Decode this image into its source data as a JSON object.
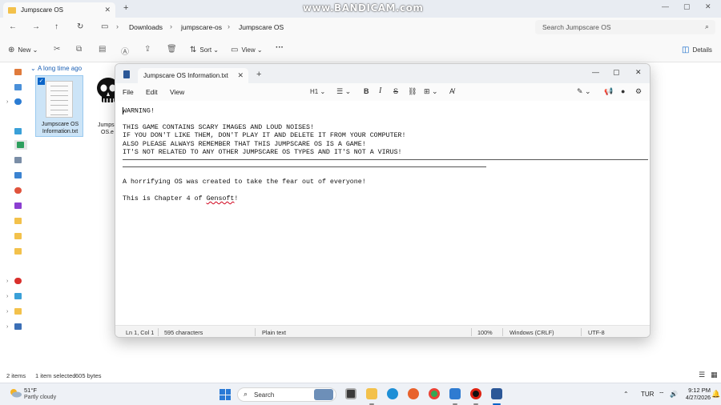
{
  "explorer": {
    "tab_title": "Jumpscare OS",
    "tab_close": "✕",
    "new_tab": "+",
    "win_min": "—",
    "win_max": "▢",
    "win_close": "✕",
    "breadcrumb": [
      "Downloads",
      "jumpscare-os",
      "Jumpscare OS"
    ],
    "search_placeholder": "Search Jumpscare OS",
    "toolbar": {
      "new_label": "New",
      "sort_label": "Sort",
      "view_label": "View",
      "more_label": "···",
      "details_label": "Details"
    },
    "group_header": "A long time ago",
    "files": [
      {
        "name": "Jumpscare OS Information.txt",
        "line1": "Jumpscare OS",
        "line2": "Information.txt",
        "selected": true
      },
      {
        "name": "Jumpscare OS.exe",
        "line1": "Jumpsc",
        "line2": "OS.e"
      }
    ],
    "status": {
      "items": "2 items",
      "selected": "1 item selected",
      "size": "605 bytes"
    }
  },
  "watermark": "www.BANDICAM.com",
  "notepad": {
    "tab_title": "Jumpscare OS Information.txt",
    "tab_close": "✕",
    "new_tab": "+",
    "win_min": "—",
    "win_max": "▢",
    "win_close": "✕",
    "menu": [
      "File",
      "Edit",
      "View"
    ],
    "format": {
      "heading": "H1",
      "bold": "B",
      "italic": "I",
      "strike": "S"
    },
    "lines": {
      "l1": "WARNING!",
      "l2": "THIS GAME CONTAINS SCARY IMAGES AND LOUD NOISES!",
      "l3": "IF YOU DON'T LIKE THEM, DON'T PLAY IT AND DELETE IT FROM YOUR COMPUTER!",
      "l4": "ALSO PLEASE ALWAYS REMEMBER THAT THIS JUMPSCARE OS IS A GAME!",
      "l5": "IT'S NOT RELATED TO ANY OTHER JUMPSCARE OS TYPES AND IT'S NOT A VIRUS!",
      "l6": "A horrifying OS was created to take the fear out of everyone!",
      "l7_pre": "This is Chapter 4 of ",
      "l7_word": "Gensoft",
      "l7_post": "!"
    },
    "status": {
      "position": "Ln 1, Col 1",
      "chars": "595 characters",
      "format": "Plain text",
      "zoom": "100%",
      "line_ending": "Windows (CRLF)",
      "encoding": "UTF-8"
    }
  },
  "taskbar": {
    "weather_temp": "51°F",
    "weather_desc": "Partly cloudy",
    "search_label": "Search",
    "language": "TUR",
    "time": "9:12 PM",
    "date": "4/27/2026"
  },
  "colors": {
    "accent": "#0a64c8",
    "selection": "#cce4f7",
    "folder": "#f3c14b",
    "spell_error": "#d0021b"
  }
}
